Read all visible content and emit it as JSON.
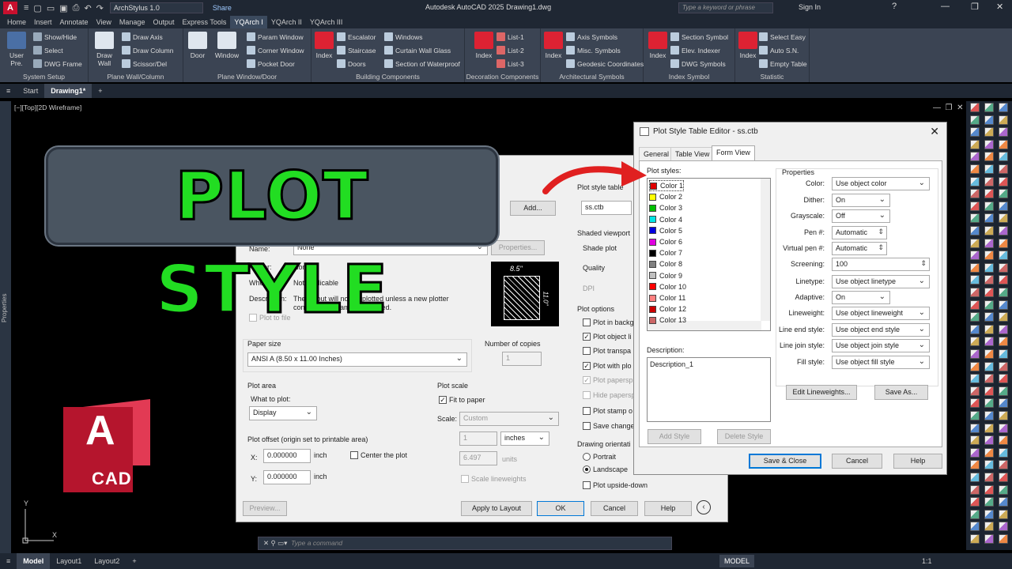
{
  "titlebar": {
    "app_title": "Autodesk AutoCAD 2025   Drawing1.dwg",
    "workspace": "ArchStylus 1.0",
    "share": "Share",
    "search_placeholder": "Type a keyword or phrase",
    "sign_in": "Sign In"
  },
  "menus": [
    "Home",
    "Insert",
    "Annotate",
    "View",
    "Manage",
    "Output",
    "Express Tools",
    "YQArch I",
    "YQArch II",
    "YQArch III"
  ],
  "ribbon": {
    "groups": [
      "System Setup",
      "Plane Wall/Column",
      "Plane Window/Door",
      "Building Components",
      "Decoration Components",
      "Architectural Symbols",
      "Index Symbol",
      "Statistic"
    ],
    "big_buttons": [
      "User Pre.",
      "Draw Wall",
      "Door",
      "Window",
      "Index",
      "Index",
      "Index",
      "Index",
      "Index"
    ],
    "small_buttons": {
      "system": [
        "Show/Hide",
        "Select",
        "DWG Frame"
      ],
      "wall": [
        "Draw Axis",
        "Draw Column",
        "Scissor/Del"
      ],
      "window": [
        "Param Window",
        "Corner Window",
        "Pocket Door"
      ],
      "building_a": [
        "Escalator",
        "Staircase",
        "Doors"
      ],
      "building_b": [
        "Windows",
        "Curtain Wall Glass",
        "Section of Waterproof"
      ],
      "decoration": [
        "List-1",
        "List-2",
        "List-3"
      ],
      "arch": [
        "Axis Symbols",
        "Misc. Symbols",
        "Geodesic Coordinates"
      ],
      "index": [
        "Section Symbol",
        "Elev. Indexer",
        "DWG Symbols"
      ],
      "statistic": [
        "Select Easy",
        "Auto S.N.",
        "Empty Table"
      ]
    }
  },
  "tabs": {
    "start": "Start",
    "drawing": "Drawing1*"
  },
  "viewport_label": "[−][Top][2D Wireframe]",
  "properties_panel": "Properties",
  "banner": "PLOT STYLE",
  "cad_logo": {
    "letter": "A",
    "text": "CAD"
  },
  "ucs": {
    "y": "Y",
    "x": "X"
  },
  "command_placeholder": "Type a command",
  "statusbar": {
    "tabs": [
      "Model",
      "Layout1",
      "Layout2"
    ],
    "model": "MODEL",
    "scale": "1:1"
  },
  "plot_dialog": {
    "add_button": "Add...",
    "name_label": "Name:",
    "name_value": "None",
    "properties_button": "Properties...",
    "plotter_label": "Plotter:",
    "plotter_value": "None",
    "where_label": "Where:",
    "where_value": "Not applicable",
    "description_label": "Description:",
    "description_value": "The layout will not be plotted unless a new plotter configuration name is selected.",
    "plot_to_file": "Plot to file",
    "paper_width": "8.5\"",
    "paper_height": "11.0\"",
    "paper_size_label": "Paper size",
    "paper_size_value": "ANSI A (8.50 x 11.00 Inches)",
    "copies_label": "Number of copies",
    "copies_value": "1",
    "plot_area_label": "Plot area",
    "what_to_plot_label": "What to plot:",
    "what_to_plot_value": "Display",
    "plot_offset_label": "Plot offset (origin set to printable area)",
    "x_label": "X:",
    "x_value": "0.000000",
    "y_label": "Y:",
    "y_value": "0.000000",
    "inch": "inch",
    "center_plot": "Center the plot",
    "plot_scale_label": "Plot scale",
    "fit_to_paper": "Fit to paper",
    "scale_label": "Scale:",
    "scale_value": "Custom",
    "scale_num": "1",
    "scale_unit": "inches",
    "scale_den": "6.497",
    "units": "units",
    "scale_lineweights": "Scale lineweights",
    "pst_label": "Plot style table",
    "pst_value": "ss.ctb",
    "shaded_label": "Shaded viewport",
    "shade_plot": "Shade plot",
    "quality": "Quality",
    "dpi": "DPI",
    "options_label": "Plot options",
    "options": [
      "Plot in backg",
      "Plot object li",
      "Plot transpa",
      "Plot with plo",
      "Plot papersp",
      "Hide papersp",
      "Plot stamp o",
      "Save change"
    ],
    "orientation_label": "Drawing orientati",
    "portrait": "Portrait",
    "landscape": "Landscape",
    "upside_down": "Plot upside-down",
    "preview": "Preview...",
    "apply_layout": "Apply to Layout",
    "ok": "OK",
    "cancel": "Cancel",
    "help": "Help"
  },
  "ps_dialog": {
    "title": "Plot Style Table Editor - ss.ctb",
    "tabs": [
      "General",
      "Table View",
      "Form View"
    ],
    "plot_styles_label": "Plot styles:",
    "colors": [
      {
        "name": "Color 1",
        "hex": "#e00000"
      },
      {
        "name": "Color 2",
        "hex": "#ffff00"
      },
      {
        "name": "Color 3",
        "hex": "#00c000"
      },
      {
        "name": "Color 4",
        "hex": "#00e5e5"
      },
      {
        "name": "Color 5",
        "hex": "#0000e0"
      },
      {
        "name": "Color 6",
        "hex": "#e000e0"
      },
      {
        "name": "Color 7",
        "hex": "#000000"
      },
      {
        "name": "Color 8",
        "hex": "#808080"
      },
      {
        "name": "Color 9",
        "hex": "#c0c0c0"
      },
      {
        "name": "Color 10",
        "hex": "#ff0000"
      },
      {
        "name": "Color 11",
        "hex": "#ff8080"
      },
      {
        "name": "Color 12",
        "hex": "#cc0000"
      },
      {
        "name": "Color 13",
        "hex": "#cc6666"
      }
    ],
    "description_label": "Description:",
    "description_value": "Description_1",
    "add_style": "Add Style",
    "delete_style": "Delete Style",
    "properties_label": "Properties",
    "props": [
      {
        "label": "Color:",
        "value": "Use object color"
      },
      {
        "label": "Dither:",
        "value": "On"
      },
      {
        "label": "Grayscale:",
        "value": "Off"
      },
      {
        "label": "Pen #:",
        "value": "Automatic"
      },
      {
        "label": "Virtual pen #:",
        "value": "Automatic"
      },
      {
        "label": "Screening:",
        "value": "100"
      },
      {
        "label": "Linetype:",
        "value": "Use object linetype"
      },
      {
        "label": "Adaptive:",
        "value": "On"
      },
      {
        "label": "Lineweight:",
        "value": "Use object lineweight"
      },
      {
        "label": "Line end style:",
        "value": "Use object end style"
      },
      {
        "label": "Line join style:",
        "value": "Use object join style"
      },
      {
        "label": "Fill style:",
        "value": "Use object fill style"
      }
    ],
    "edit_lineweights": "Edit Lineweights...",
    "save_as": "Save As...",
    "save_close": "Save & Close",
    "cancel": "Cancel",
    "help": "Help"
  }
}
